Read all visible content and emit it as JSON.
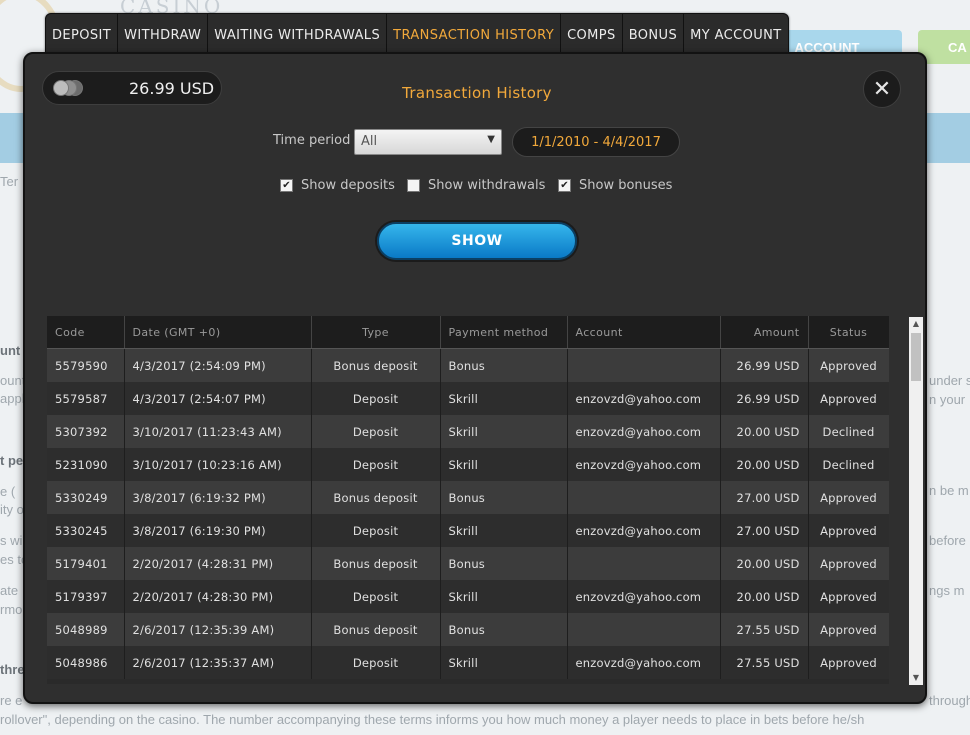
{
  "background": {
    "logo_text": "CASINO",
    "account_button": "ACCOUNT",
    "cash_button": "CA",
    "snippets": [
      "Ter",
      "unt",
      "ount",
      "appl",
      "t pe",
      "e (",
      "ity o",
      "s wi",
      "es to",
      "ate",
      "rmo",
      "thre",
      "under s",
      "n your",
      "n be m",
      "before",
      "ngs m",
      "re e",
      "through",
      "rollover\", depending on the casino. The number accompanying these terms informs you how much money a player needs to place in bets before he/sh"
    ]
  },
  "tabs": [
    {
      "label": "DEPOSIT",
      "active": false
    },
    {
      "label": "WITHDRAW",
      "active": false
    },
    {
      "label": "WAITING WITHDRAWALS",
      "active": false
    },
    {
      "label": "TRANSACTION HISTORY",
      "active": true
    },
    {
      "label": "COMPS",
      "active": false
    },
    {
      "label": "BONUS",
      "active": false
    },
    {
      "label": "MY ACCOUNT",
      "active": false
    }
  ],
  "modal": {
    "balance": "26.99 USD",
    "title": "Transaction History",
    "close_symbol": "✕"
  },
  "filters": {
    "time_period_label": "Time period",
    "time_period_value": "All",
    "date_range": "1/1/2010 - 4/4/2017",
    "show_deposits": {
      "label": "Show deposits",
      "checked": true
    },
    "show_withdrawals": {
      "label": "Show withdrawals",
      "checked": false
    },
    "show_bonuses": {
      "label": "Show bonuses",
      "checked": true
    },
    "show_button": "SHOW"
  },
  "table": {
    "columns": [
      "Code",
      "Date (GMT +0)",
      "Type",
      "Payment method",
      "Account",
      "Amount",
      "Status"
    ],
    "rows": [
      [
        "5579590",
        "4/3/2017 (2:54:09 PM)",
        "Bonus deposit",
        "Bonus",
        "",
        "26.99 USD",
        "Approved"
      ],
      [
        "5579587",
        "4/3/2017 (2:54:07 PM)",
        "Deposit",
        "Skrill",
        "enzovzd@yahoo.com",
        "26.99 USD",
        "Approved"
      ],
      [
        "5307392",
        "3/10/2017 (11:23:43 AM)",
        "Deposit",
        "Skrill",
        "enzovzd@yahoo.com",
        "20.00 USD",
        "Declined"
      ],
      [
        "5231090",
        "3/10/2017 (10:23:16 AM)",
        "Deposit",
        "Skrill",
        "enzovzd@yahoo.com",
        "20.00 USD",
        "Declined"
      ],
      [
        "5330249",
        "3/8/2017 (6:19:32 PM)",
        "Bonus deposit",
        "Bonus",
        "",
        "27.00 USD",
        "Approved"
      ],
      [
        "5330245",
        "3/8/2017 (6:19:30 PM)",
        "Deposit",
        "Skrill",
        "enzovzd@yahoo.com",
        "27.00 USD",
        "Approved"
      ],
      [
        "5179401",
        "2/20/2017 (4:28:31 PM)",
        "Bonus deposit",
        "Bonus",
        "",
        "20.00 USD",
        "Approved"
      ],
      [
        "5179397",
        "2/20/2017 (4:28:30 PM)",
        "Deposit",
        "Skrill",
        "enzovzd@yahoo.com",
        "20.00 USD",
        "Approved"
      ],
      [
        "5048989",
        "2/6/2017 (12:35:39 AM)",
        "Bonus deposit",
        "Bonus",
        "",
        "27.55 USD",
        "Approved"
      ],
      [
        "5048986",
        "2/6/2017 (12:35:37 AM)",
        "Deposit",
        "Skrill",
        "enzovzd@yahoo.com",
        "27.55 USD",
        "Approved"
      ]
    ]
  },
  "colors": {
    "accent": "#f2a93b",
    "modal_bg": "#2f2f2f",
    "button_blue": "#1a9be0"
  }
}
